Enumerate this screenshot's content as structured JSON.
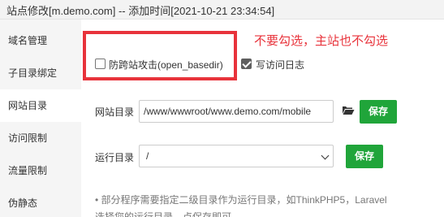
{
  "window": {
    "title": "站点修改[m.demo.com] -- 添加时间[2021-10-21 23:34:54]"
  },
  "sidebar": {
    "items": [
      {
        "label": "域名管理"
      },
      {
        "label": "子目录绑定"
      },
      {
        "label": "网站目录"
      },
      {
        "label": "访问限制"
      },
      {
        "label": "流量限制"
      },
      {
        "label": "伪静态"
      }
    ],
    "active_index": 2
  },
  "annotation": {
    "text": "不要勾选，主站也不勾选",
    "color": "#e8333b"
  },
  "options": {
    "open_basedir": {
      "label": "防跨站攻击(open_basedir)",
      "checked": false
    },
    "access_log": {
      "label": "写访问日志",
      "checked": true
    }
  },
  "site_dir": {
    "label": "网站目录",
    "value": "/www/wwwroot/www.demo.com/mobile",
    "folder_icon": "folder-open-icon",
    "save_label": "保存"
  },
  "run_dir": {
    "label": "运行目录",
    "selected": "/",
    "save_label": "保存"
  },
  "note": {
    "line1": "•  部分程序需要指定二级目录作为运行目录，如ThinkPHP5，Laravel",
    "line2": "选择您的运行目录，点保存即可"
  },
  "colors": {
    "primary_button": "#20a53a",
    "highlight_box": "#e8333b"
  }
}
